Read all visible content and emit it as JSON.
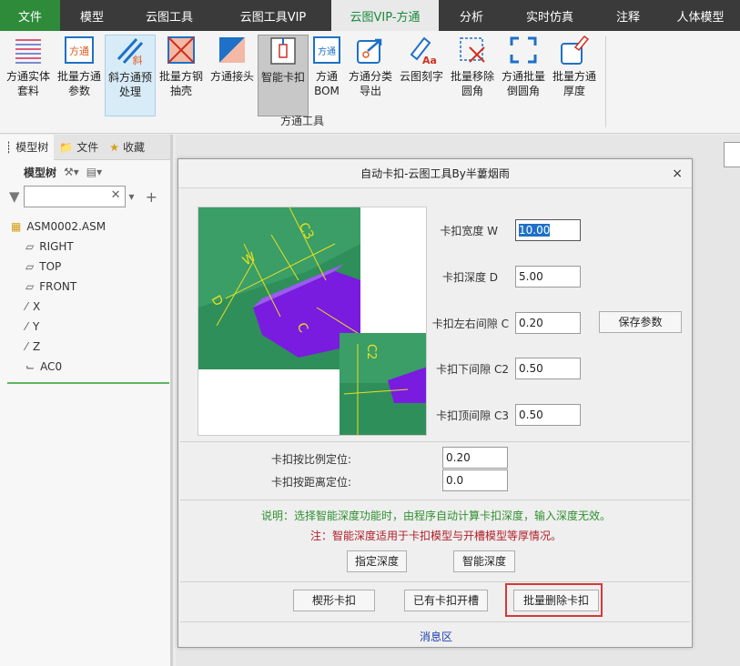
{
  "tabs": [
    {
      "label": "文件"
    },
    {
      "label": "模型"
    },
    {
      "label": "云图工具"
    },
    {
      "label": "云图工具VIP"
    },
    {
      "label": "云图VIP-方通"
    },
    {
      "label": "分析"
    },
    {
      "label": "实时仿真"
    },
    {
      "label": "注释"
    },
    {
      "label": "人体模型"
    }
  ],
  "ribbon": {
    "buttons": [
      {
        "line1": "方通实体",
        "line2": "套料",
        "icon": "lines-list-icon"
      },
      {
        "line1": "批量方通",
        "line2": "参数",
        "icon": "fangtong-param-icon"
      },
      {
        "line1": "斜方通预",
        "line2": "处理",
        "icon": "diagonal-icon"
      },
      {
        "line1": "批量方钢",
        "line2": "抽壳",
        "icon": "shell-icon"
      },
      {
        "line1": "方通接头",
        "line2": "",
        "icon": "joint-icon"
      },
      {
        "line1": "智能卡扣",
        "line2": "",
        "icon": "clip-icon"
      },
      {
        "line1": "方通",
        "line2": "BOM",
        "icon": "bom-icon"
      },
      {
        "line1": "方通分类",
        "line2": "导出",
        "icon": "export-icon"
      },
      {
        "line1": "云图刻字",
        "line2": "",
        "icon": "engrave-icon"
      },
      {
        "line1": "批量移除",
        "line2": "圆角",
        "icon": "remove-round-icon"
      },
      {
        "line1": "方通批量",
        "line2": "倒圆角",
        "icon": "round-icon"
      },
      {
        "line1": "批量方通",
        "line2": "厚度",
        "icon": "thickness-icon"
      }
    ],
    "group_label": "方通工具",
    "icon_texts": {
      "fangtong": "方通",
      "xie": "斜",
      "bom": "方通",
      "aa": "Aa"
    }
  },
  "left_panel": {
    "tabs": [
      {
        "label": "模型树",
        "icon": "model-tree-icon"
      },
      {
        "label": "文件",
        "icon": "folder-icon"
      },
      {
        "label": "收藏",
        "icon": "favorites-icon"
      }
    ],
    "toolbar_label": "模型树",
    "filter_placeholder": "",
    "tree": [
      {
        "label": "ASM0002.ASM",
        "icon": "assembly-icon",
        "level": 0
      },
      {
        "label": "RIGHT",
        "icon": "plane-icon",
        "level": 1
      },
      {
        "label": "TOP",
        "icon": "plane-icon",
        "level": 1
      },
      {
        "label": "FRONT",
        "icon": "plane-icon",
        "level": 1
      },
      {
        "label": "X",
        "icon": "axis-icon",
        "level": 1
      },
      {
        "label": "Y",
        "icon": "axis-icon",
        "level": 1
      },
      {
        "label": "Z",
        "icon": "axis-icon",
        "level": 1
      },
      {
        "label": "AC0",
        "icon": "csys-icon",
        "level": 1
      }
    ]
  },
  "dialog": {
    "title": "自动卡扣-云图工具By半蔞烟雨",
    "fields": {
      "width_label": "卡扣宽度 W",
      "width_value": "10.00",
      "depth_label": "卡扣深度 D",
      "depth_value": "5.00",
      "lr_gap_label": "卡扣左右间隙 C",
      "lr_gap_value": "0.20",
      "bottom_gap_label": "卡扣下间隙 C2",
      "bottom_gap_value": "0.50",
      "top_gap_label": "卡扣顶间隙 C3",
      "top_gap_value": "0.50",
      "ratio_label": "卡扣按比例定位:",
      "ratio_value": "0.20",
      "distance_label": "卡扣按距离定位:",
      "distance_value": "0.0"
    },
    "save_button": "保存参数",
    "note1": "说明：选择智能深度功能时，由程序自动计算卡扣深度，输入深度无效。",
    "note2": "注：智能深度适用于卡扣模型与开槽模型等厚情况。",
    "buttons": {
      "specify_depth": "指定深度",
      "smart_depth": "智能深度",
      "wedge_clip": "楔形卡扣",
      "existing_slot": "已有卡扣开槽",
      "batch_delete": "批量删除卡扣"
    },
    "message_area": "消息区",
    "image_labels": {
      "w": "W",
      "c3": "C3",
      "d": "D",
      "c": "C",
      "c2": "C2"
    }
  },
  "colors": {
    "accent_green": "#2e8b3a",
    "tab_bar": "#3a3a3a",
    "highlight_red": "#d73838",
    "note_green": "#2f8f2f",
    "note_red": "#b0202a",
    "model_green": "#2f8f5a",
    "model_purple": "#7a1be0"
  }
}
